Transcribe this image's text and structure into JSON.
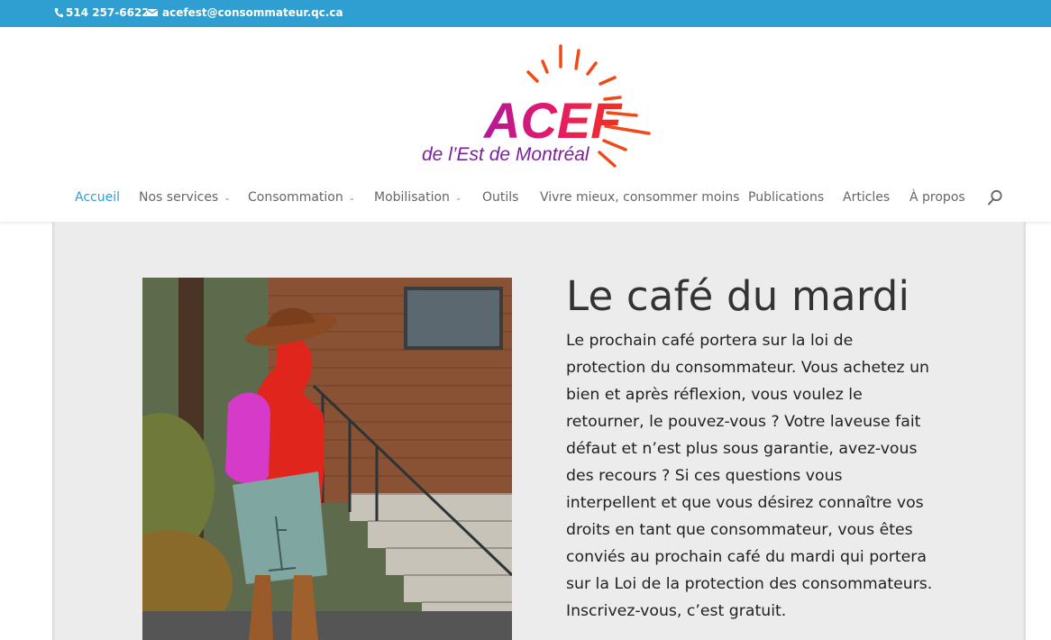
{
  "topbar": {
    "phone": "514 257-6622",
    "email": "acefest@consommateur.qc.ca",
    "background": "#2e9fd0"
  },
  "logo": {
    "name": "ACEF",
    "tagline": "de l’Est de Montréal"
  },
  "nav": {
    "items": [
      {
        "label": "Accueil",
        "active": true,
        "has_submenu": false
      },
      {
        "label": "Nos services",
        "active": false,
        "has_submenu": true
      },
      {
        "label": "Consommation",
        "active": false,
        "has_submenu": true
      },
      {
        "label": "Mobilisation",
        "active": false,
        "has_submenu": true
      },
      {
        "label": "Outils",
        "active": false,
        "has_submenu": false
      },
      {
        "label": "Vivre mieux, consommer moins",
        "active": false,
        "has_submenu": false
      },
      {
        "label": "Publications",
        "active": false,
        "has_submenu": false
      },
      {
        "label": "Articles",
        "active": false,
        "has_submenu": false
      },
      {
        "label": "À propos",
        "active": false,
        "has_submenu": false
      }
    ],
    "submenu_glyph": "⌄",
    "search_icon": "search-icon",
    "active_color": "#2e9fd0"
  },
  "feature": {
    "title": "Le café du mardi",
    "body": "Le prochain café portera sur la loi de protection du consommateur. Vous achetez un bien et après réflexion, vous voulez le retourner, le pouvez-vous ? Votre laveuse fait défaut et n’est plus sous garantie, avez-vous des recours ? Si ces questions vous interpellent et que vous désirez connaître vos droits en tant que consommateur, vous êtes conviés au prochain café du mardi qui portera sur la Loi de la protection des consommateurs. Inscrivez-vous, c’est gratuit."
  }
}
